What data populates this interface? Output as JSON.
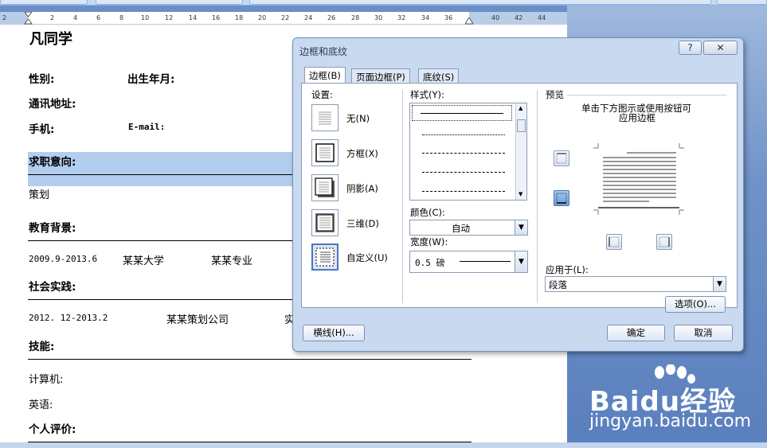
{
  "ruler": {
    "ticks": [
      "2",
      "2",
      "4",
      "6",
      "8",
      "10",
      "12",
      "14",
      "16",
      "18",
      "20",
      "22",
      "24",
      "26",
      "28",
      "30",
      "32",
      "34",
      "36",
      "40",
      "42",
      "44"
    ]
  },
  "document": {
    "name_title": "凡同学",
    "gender_label": "性别:",
    "birth_label": "出生年月:",
    "address_label": "通讯地址:",
    "phone_label": "手机:",
    "email_label": "E-mail:",
    "job_intent_label": "求职意向:",
    "job_intent_value": "策划",
    "education_label": "教育背景:",
    "education_dates": "2009.9-2013.6",
    "education_school": "某某大学",
    "education_major": "某某专业",
    "practice_label": "社会实践:",
    "practice_dates": "2012. 12-2013.2",
    "practice_company": "某某策划公司",
    "practice_extra": "实",
    "skills_label": "技能:",
    "computer_label": "计算机:",
    "english_label": "英语:",
    "self_eval_label": "个人评价:"
  },
  "dialog": {
    "title": "边框和底纹",
    "help": "?",
    "close": "✕",
    "tabs": [
      "边框(B)",
      "页面边框(P)",
      "底纹(S)"
    ],
    "settings_label": "设置:",
    "settings": [
      "无(N)",
      "方框(X)",
      "阴影(A)",
      "三维(D)",
      "自定义(U)"
    ],
    "style_label": "样式(Y):",
    "color_label": "颜色(C):",
    "color_value": "自动",
    "width_label": "宽度(W):",
    "width_value": "0.5 磅",
    "preview_label": "预览",
    "preview_hint_1": "单击下方图示或使用按钮可",
    "preview_hint_2": "应用边框",
    "apply_to_label": "应用于(L):",
    "apply_to_value": "段落",
    "options_button": "选项(O)...",
    "hline_button": "横线(H)...",
    "ok_button": "确定",
    "cancel_button": "取消"
  },
  "watermark": {
    "brand": "Baidu经验",
    "url": "jingyan.baidu.com"
  }
}
